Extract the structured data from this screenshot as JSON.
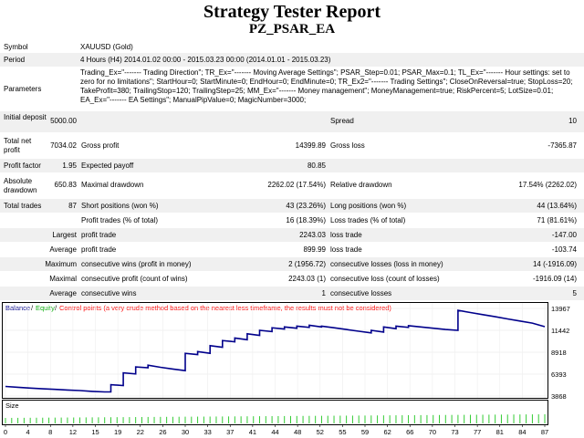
{
  "report": {
    "title": "Strategy Tester Report",
    "subtitle": "PZ_PSAR_EA"
  },
  "summary": {
    "symbol_label": "Symbol",
    "symbol_value": "XAUUSD (Gold)",
    "period_label": "Period",
    "period_value": "4 Hours (H4) 2014.01.02 00:00 - 2015.03.23 00:00 (2014.01.01 - 2015.03.23)",
    "parameters_label": "Parameters",
    "parameters_value": "Trading_Ex=\"------- Trading Direction\"; TR_Ex=\"------- Moving Average Settings\"; PSAR_Step=0.01; PSAR_Max=0.1; TL_Ex=\"------- Hour settings: set to zero for no limitations\"; StartHour=0; StartMinute=0; EndHour=0; EndMinute=0; TR_Ex2=\"------- Trading Settings\"; CloseOnReversal=true; StopLoss=20; TakeProfit=380; TrailingStop=120; TrailingStep=25; MM_Ex=\"------- Money management\"; MoneyManagement=true; RiskPercent=5; LotSize=0.01; EA_Ex=\"------- EA Settings\"; ManualPipValue=0; MagicNumber=3000;"
  },
  "stats": {
    "initial_deposit_label": "Initial deposit",
    "initial_deposit_value": "5000.00",
    "spread_label": "Spread",
    "spread_value": "10",
    "total_net_profit_label": "Total net profit",
    "total_net_profit_value": "7034.02",
    "gross_profit_label": "Gross profit",
    "gross_profit_value": "14399.89",
    "gross_loss_label": "Gross loss",
    "gross_loss_value": "-7365.87",
    "profit_factor_label": "Profit factor",
    "profit_factor_value": "1.95",
    "expected_payoff_label": "Expected payoff",
    "expected_payoff_value": "80.85",
    "absolute_drawdown_label": "Absolute drawdown",
    "absolute_drawdown_value": "650.83",
    "maximal_drawdown_label": "Maximal drawdown",
    "maximal_drawdown_value": "2262.02 (17.54%)",
    "relative_drawdown_label": "Relative drawdown",
    "relative_drawdown_value": "17.54% (2262.02)",
    "total_trades_label": "Total trades",
    "total_trades_value": "87",
    "short_positions_label": "Short positions (won %)",
    "short_positions_value": "43 (23.26%)",
    "long_positions_label": "Long positions (won %)",
    "long_positions_value": "44 (13.64%)",
    "profit_trades_label": "Profit trades (% of total)",
    "profit_trades_value": "16 (18.39%)",
    "loss_trades_label": "Loss trades (% of total)",
    "loss_trades_value": "71 (81.61%)",
    "largest_label": "Largest",
    "largest_profit_label": "profit trade",
    "largest_profit_value": "2243.03",
    "largest_loss_label": "loss trade",
    "largest_loss_value": "-147.00",
    "average_label": "Average",
    "average_profit_label": "profit trade",
    "average_profit_value": "899.99",
    "average_loss_label": "loss trade",
    "average_loss_value": "-103.74",
    "maximum_label": "Maximum",
    "max_cons_wins_label": "consecutive wins (profit in money)",
    "max_cons_wins_value": "2 (1956.72)",
    "max_cons_losses_label": "consecutive losses (loss in money)",
    "max_cons_losses_value": "14 (-1916.09)",
    "maximal_label": "Maximal",
    "maximal_cons_profit_label": "consecutive profit (count of wins)",
    "maximal_cons_profit_value": "2243.03 (1)",
    "maximal_cons_loss_label": "consecutive loss (count of losses)",
    "maximal_cons_loss_value": "-1916.09 (14)",
    "average2_label": "Average",
    "avg_cons_wins_label": "consecutive wins",
    "avg_cons_wins_value": "1",
    "avg_cons_losses_label": "consecutive losses",
    "avg_cons_losses_value": "5"
  },
  "chart_data": {
    "type": "line",
    "legend": {
      "balance": "Balance",
      "equity": "Equity",
      "note": "Control points (a very crude method based on the nearest less timeframe, the results must not be considered)"
    },
    "colors": {
      "balance": "#00008b",
      "equity": "#00aa00",
      "note": "#ff0000",
      "size_bars": "#33cc33"
    },
    "y_ticks": [
      "13967",
      "11442",
      "8918",
      "6393",
      "3868"
    ],
    "x_ticks": [
      "0",
      "4",
      "8",
      "12",
      "15",
      "19",
      "22",
      "26",
      "30",
      "33",
      "37",
      "41",
      "44",
      "48",
      "52",
      "55",
      "59",
      "62",
      "66",
      "70",
      "73",
      "77",
      "81",
      "84",
      "87"
    ],
    "size_label": "Size",
    "ylim": [
      3868,
      13967
    ],
    "xlim": [
      0,
      87
    ],
    "balance": [
      [
        0,
        5000
      ],
      [
        2,
        4900
      ],
      [
        4,
        4800
      ],
      [
        6,
        4720
      ],
      [
        8,
        4650
      ],
      [
        10,
        4580
      ],
      [
        12,
        4510
      ],
      [
        14,
        4420
      ],
      [
        16,
        4349
      ],
      [
        17,
        4349
      ],
      [
        17,
        5200
      ],
      [
        19,
        5100
      ],
      [
        19,
        6600
      ],
      [
        21,
        6470
      ],
      [
        21,
        7300
      ],
      [
        23,
        7200
      ],
      [
        23,
        7500
      ],
      [
        25,
        7250
      ],
      [
        27,
        7050
      ],
      [
        29,
        6850
      ],
      [
        29,
        8900
      ],
      [
        31,
        8750
      ],
      [
        31,
        9100
      ],
      [
        33,
        8900
      ],
      [
        33,
        9800
      ],
      [
        35,
        9600
      ],
      [
        35,
        10400
      ],
      [
        37,
        10250
      ],
      [
        37,
        10700
      ],
      [
        39,
        10500
      ],
      [
        39,
        11200
      ],
      [
        41,
        11000
      ],
      [
        41,
        11600
      ],
      [
        43,
        11450
      ],
      [
        43,
        11900
      ],
      [
        45,
        11750
      ],
      [
        45,
        12000
      ],
      [
        47,
        11850
      ],
      [
        47,
        12100
      ],
      [
        49,
        11950
      ],
      [
        49,
        12200
      ],
      [
        51,
        12000
      ],
      [
        51,
        12100
      ],
      [
        53,
        11900
      ],
      [
        55,
        11700
      ],
      [
        57,
        11500
      ],
      [
        59,
        11300
      ],
      [
        59,
        11600
      ],
      [
        61,
        11400
      ],
      [
        61,
        12000
      ],
      [
        63,
        11800
      ],
      [
        63,
        12100
      ],
      [
        65,
        11950
      ],
      [
        65,
        12150
      ],
      [
        67,
        12000
      ],
      [
        69,
        11850
      ],
      [
        71,
        11700
      ],
      [
        73,
        11600
      ],
      [
        73,
        13960
      ],
      [
        75,
        13700
      ],
      [
        77,
        13450
      ],
      [
        79,
        13200
      ],
      [
        81,
        12950
      ],
      [
        83,
        12700
      ],
      [
        85,
        12450
      ],
      [
        87,
        12034
      ]
    ]
  }
}
